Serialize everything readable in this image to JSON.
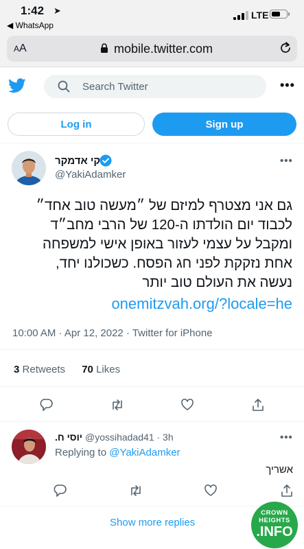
{
  "status_bar": {
    "time": "1:42",
    "back_app": "◀ WhatsApp",
    "network": "LTE"
  },
  "browser": {
    "text_size_label": "AA",
    "url": "mobile.twitter.com"
  },
  "header": {
    "search_placeholder": "Search Twitter",
    "more": "•••"
  },
  "auth": {
    "login_label": "Log in",
    "signup_label": "Sign up"
  },
  "tweet": {
    "author_name": "יקי אדמקר",
    "author_handle": "@YakiAdamker",
    "text_lines": [
      "גם אני מצטרף למיזם של ״מעשה טוב אחד״",
      "לכבוד יום הולדתו ה-120 של הרבי מחב״ד",
      "ומקבל על עצמי לעזור באופן אישי למשפחה",
      "אחת נזקקת לפני חג הפסח. כשכולנו יחד,",
      "נעשה את העולם טוב יותר"
    ],
    "link": "onemitzvah.org/?locale=he",
    "meta": "10:00 AM · Apr 12, 2022 · Twitter for iPhone",
    "retweets_count": "3",
    "retweets_label": "Retweets",
    "likes_count": "70",
    "likes_label": "Likes",
    "more": "•••"
  },
  "reply": {
    "author_name": "יוסי ח.",
    "author_handle": "@yossihadad41 · 3h",
    "replying_prefix": "Replying to ",
    "replying_to": "@YakiAdamker",
    "text": "אשריך",
    "more": "•••"
  },
  "footer": {
    "show_more": "Show more replies"
  },
  "watermark": {
    "line1": "CROWN",
    "line2": "HEIGHTS",
    "line3": ".INFO"
  },
  "colors": {
    "accent": "#1d9bf0",
    "text": "#0f1419",
    "muted": "#536471",
    "logo_green": "#27a84a"
  }
}
